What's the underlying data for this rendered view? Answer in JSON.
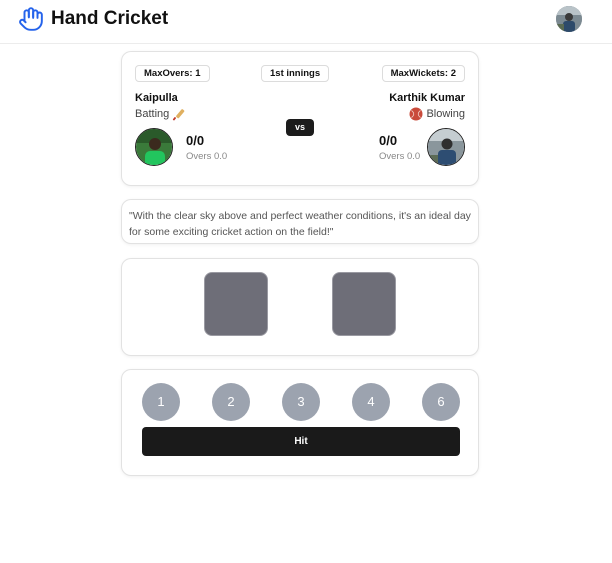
{
  "app": {
    "title": "Hand Cricket",
    "brand_icon": "hand-icon",
    "accent": "#2563eb"
  },
  "match": {
    "max_overs": "MaxOvers: 1",
    "innings": "1st innings",
    "max_wickets": "MaxWickets: 2",
    "vs": "vs"
  },
  "player1": {
    "name": "Kaipulla",
    "role": "Batting",
    "role_icon": "cricket-bat-icon",
    "score": "0/0",
    "overs": "Overs 0.0"
  },
  "player2": {
    "name": "Karthik Kumar",
    "role": "Blowing",
    "role_icon": "cricket-ball-icon",
    "score": "0/0",
    "overs": "Overs 0.0"
  },
  "commentary": "\"With the clear sky above and perfect weather conditions, it's an ideal day for some exciting cricket action on the field!\"",
  "controls": {
    "numbers": [
      "1",
      "2",
      "3",
      "4",
      "6"
    ],
    "hit_label": "Hit",
    "button_color": "#9ca3af",
    "hit_color": "#1a1a1a"
  }
}
